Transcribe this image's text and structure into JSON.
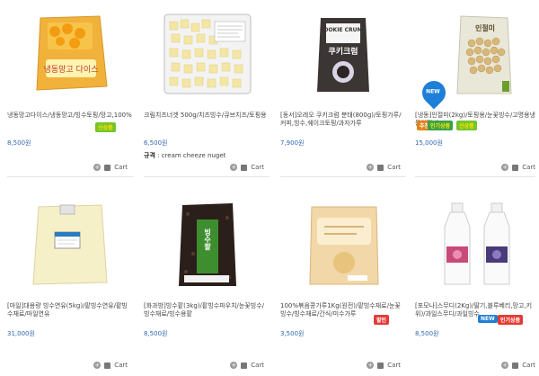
{
  "products": [
    {
      "name": "냉동망고다이스/냉동망고/빙수토핑/망고,100%",
      "price": "8,500원",
      "cart": "Cart",
      "badge": "신상품",
      "badge_color": "#74c52b"
    },
    {
      "name": "크림치즈너겟 500g/치즈빙수/큐브치즈/토핑용",
      "price": "6,500원",
      "spec_label": "규격",
      "spec": ": cream cheeze nuget",
      "cart": "Cart"
    },
    {
      "name": "[동서]오레오 쿠키크럼 분태(800g)/토핑가루/커피,빙수,쉐이크토핑/과자가루",
      "price": "7,900원",
      "cart": "Cart"
    },
    {
      "name": "[냉동]인절미(2kg)/토핑용/눈꽃빙수/고명용냉동인절미",
      "price": "15,000원",
      "cart": "Cart",
      "badges": [
        "추천",
        "인기상품",
        "신상품"
      ]
    },
    {
      "name": "[마일]대용량 빙수연유(5kg)/팥빙수연유/팥빙수재료/마일연유",
      "price": "31,000원",
      "cart": "Cart"
    },
    {
      "name": "[화과방]빙수팥(3kg)/팥빙수파우치/눈꽃빙수/빙수재료/빙수용팥",
      "price": "8,500원",
      "cart": "Cart"
    },
    {
      "name": "100%볶음콩가루1Kg(원전)/팥빙수재료/눈꽃빙수/빙수재료/간식/미수가루",
      "price": "3,500원",
      "cart": "Cart",
      "badge": "할인",
      "badge_color": "#e53935"
    },
    {
      "name": "[포모나]스무디(2Kg)/딸기,블루베리,망고,키위)/과일스무디/과일빙수",
      "price": "8,500원",
      "cart": "Cart",
      "badges": [
        "NEW",
        "인기상품"
      ]
    }
  ],
  "new_label": "NEW",
  "images": {
    "p1_label": "냉동망고 다이스",
    "p3_label": "COOKIE CRUMB",
    "p3_label2": "쿠키크럼",
    "p4_label": "인절미",
    "p6_label": "빙수팥"
  }
}
